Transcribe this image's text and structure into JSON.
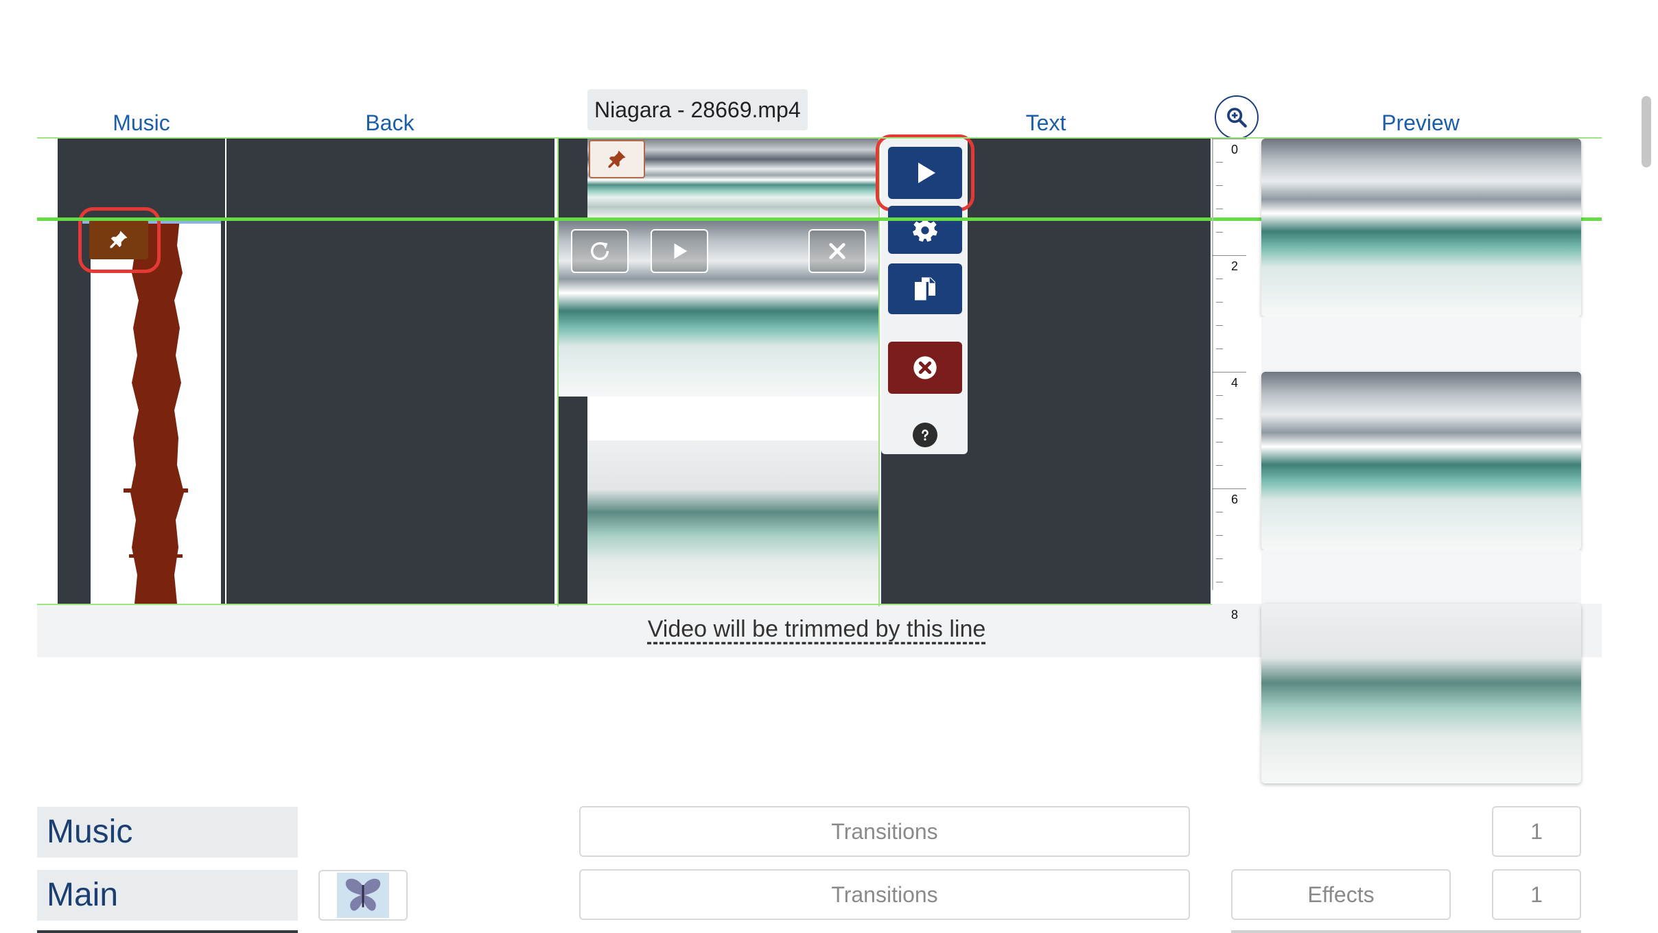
{
  "columns": {
    "music": "Music",
    "back": "Back",
    "text": "Text",
    "preview": "Preview"
  },
  "clip": {
    "filename": "Niagara - 28669.mp4"
  },
  "trim_notice": "Video will be trimmed by this line",
  "ruler": {
    "labels": [
      "0",
      "2",
      "4",
      "6",
      "8"
    ]
  },
  "icons": {
    "zoom": "zoom-in-icon",
    "pin": "pin-icon",
    "refresh": "refresh-icon",
    "play": "play-icon",
    "close": "close-icon",
    "settings": "gear-icon",
    "copy": "copy-icon",
    "delete": "delete-icon",
    "help": "help-icon",
    "butterfly": "butterfly-icon"
  },
  "bottom": {
    "music_row": {
      "label": "Music",
      "transitions": "Transitions",
      "count": "1"
    },
    "main_row": {
      "label": "Main",
      "transitions": "Transitions",
      "effects": "Effects",
      "count": "1"
    }
  },
  "colors": {
    "track_bg": "#343a40",
    "header_link": "#1c5fa8",
    "primary_button": "#1b3f7a",
    "delete_button": "#7b1d1d",
    "highlight_ring": "#e53935",
    "guide_line": "#66dd44",
    "pin_music": "#7a3a10",
    "waveform": "#7a2410"
  }
}
